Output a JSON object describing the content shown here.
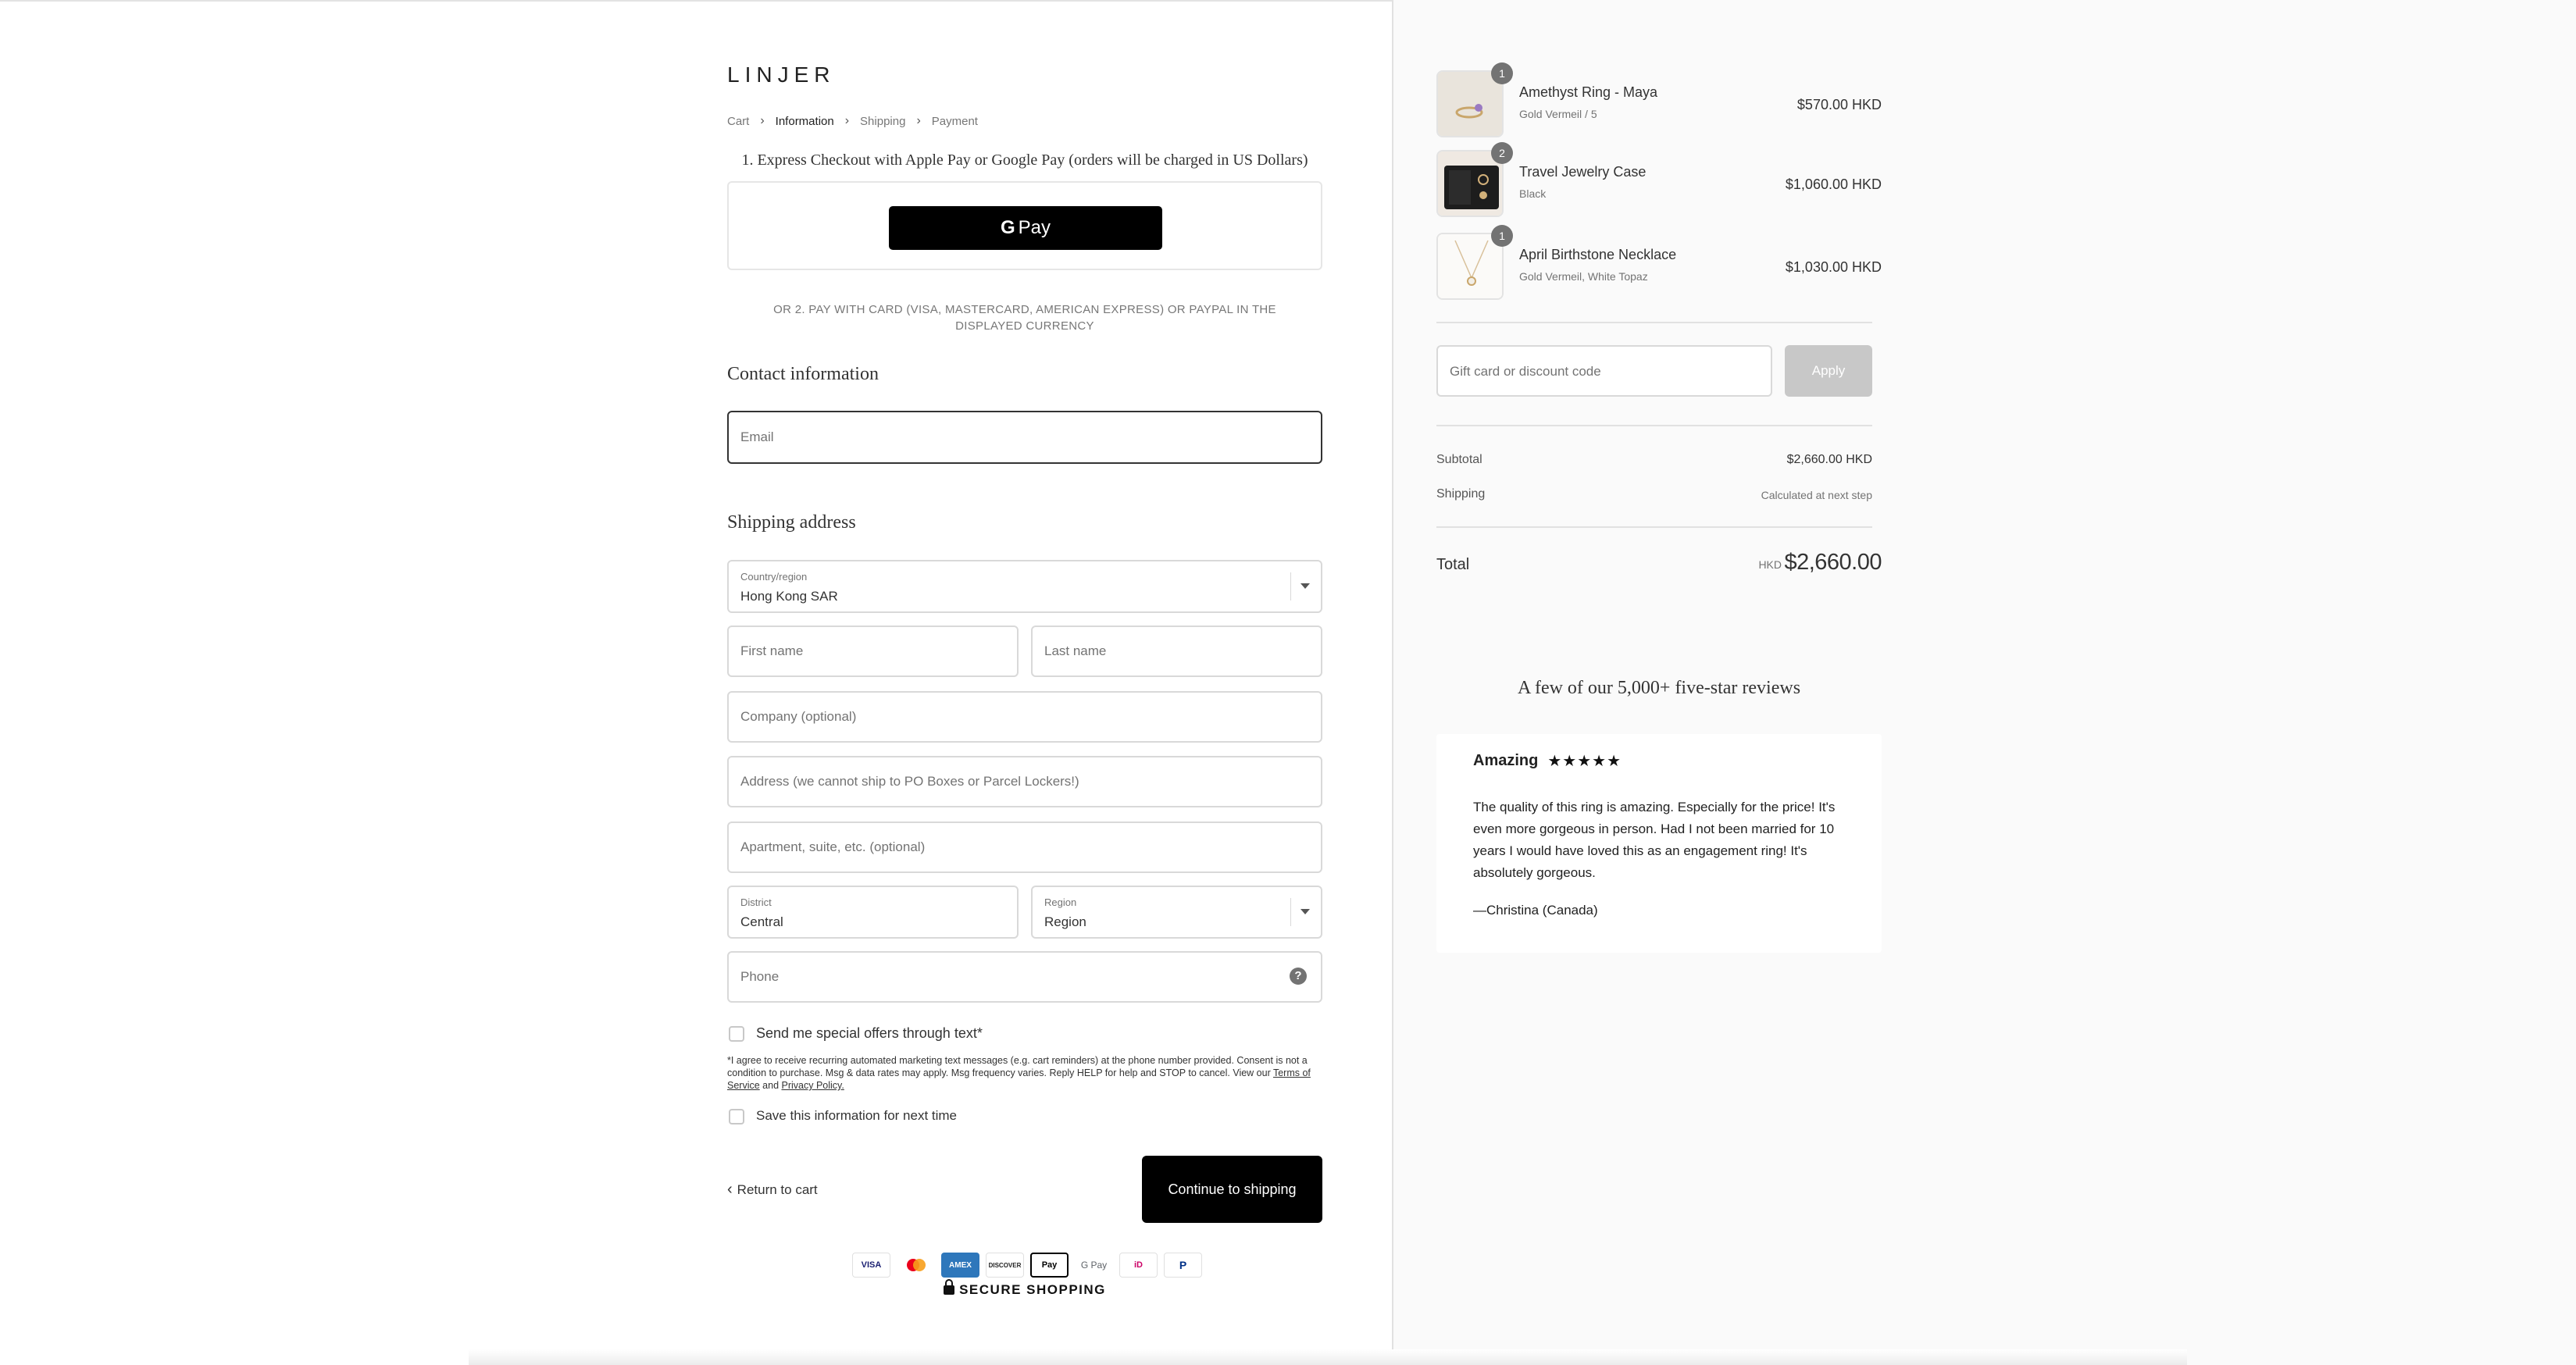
{
  "brand": {
    "logo_text": "LINJER"
  },
  "breadcrumb": {
    "items": [
      "Cart",
      "Information",
      "Shipping",
      "Payment"
    ],
    "current": "Information"
  },
  "express": {
    "title": "1. Express Checkout with Apple Pay or Google Pay (orders will be charged in US Dollars)",
    "gpay_g": "G",
    "gpay_label": "Pay"
  },
  "or_text": "OR 2. PAY WITH CARD (VISA, MASTERCARD, AMERICAN EXPRESS) OR PAYPAL IN THE DISPLAYED CURRENCY",
  "contact": {
    "heading": "Contact information",
    "email_placeholder": "Email"
  },
  "shipping": {
    "heading": "Shipping address",
    "country_label": "Country/region",
    "country_value": "Hong Kong SAR",
    "first_name_placeholder": "First name",
    "last_name_placeholder": "Last name",
    "company_placeholder": "Company (optional)",
    "address_placeholder": "Address (we cannot ship to PO Boxes or Parcel Lockers!)",
    "apartment_placeholder": "Apartment, suite, etc. (optional)",
    "district_label": "District",
    "district_value": "Central",
    "region_label": "Region",
    "region_value": "Region",
    "phone_placeholder": "Phone",
    "help_glyph": "?"
  },
  "sms": {
    "checkbox_label": "Send me special offers through text*",
    "fine_print_before": "*I agree to receive recurring automated marketing text messages (e.g. cart reminders) at the phone number provided. Consent is not a condition to purchase. Msg & data rates may apply. Msg frequency varies. Reply HELP for help and STOP to cancel. View our ",
    "terms_link": "Terms of Service",
    "and_text": " and ",
    "privacy_link": "Privacy Policy."
  },
  "save_info_label": "Save this information for next time",
  "nav": {
    "return_label": "Return to cart",
    "continue_label": "Continue to shipping"
  },
  "payment_icons": [
    {
      "name": "visa",
      "label": "VISA"
    },
    {
      "name": "mastercard",
      "label": "MC"
    },
    {
      "name": "amex",
      "label": "AMEX"
    },
    {
      "name": "discover",
      "label": "DISCOVER"
    },
    {
      "name": "apple-pay",
      "label": "Pay"
    },
    {
      "name": "google-pay",
      "label": "G Pay"
    },
    {
      "name": "ideal",
      "label": "iD"
    },
    {
      "name": "paypal",
      "label": "P"
    }
  ],
  "secure_label": "SECURE SHOPPING",
  "cart": {
    "items": [
      {
        "name": "Amethyst Ring - Maya",
        "variant": "Gold Vermeil / 5",
        "price": "$570.00 HKD",
        "qty": "1"
      },
      {
        "name": "Travel Jewelry Case",
        "variant": "Black",
        "price": "$1,060.00 HKD",
        "qty": "2"
      },
      {
        "name": "April Birthstone Necklace",
        "variant": "Gold Vermeil, White Topaz",
        "price": "$1,030.00 HKD",
        "qty": "1"
      }
    ],
    "discount_placeholder": "Gift card or discount code",
    "apply_label": "Apply",
    "subtotal_label": "Subtotal",
    "subtotal_value": "$2,660.00 HKD",
    "shipping_label": "Shipping",
    "shipping_value": "Calculated at next step",
    "total_label": "Total",
    "total_currency": "HKD",
    "total_value": "$2,660.00"
  },
  "reviews": {
    "title": "A few of our 5,000+ five-star reviews",
    "review_title": "Amazing",
    "stars": "★★★★★",
    "rating": 5,
    "body": "The quality of this ring is amazing. Especially for the price! It's even more gorgeous in person. Had I not been married for 10 years I would have loved this as an engagement ring! It's absolutely gorgeous.",
    "author": "—Christina (Canada)"
  },
  "colors": {
    "accent": "#000000",
    "muted": "#737373",
    "border": "#d9d9d9",
    "panel_bg": "#fafafa"
  }
}
